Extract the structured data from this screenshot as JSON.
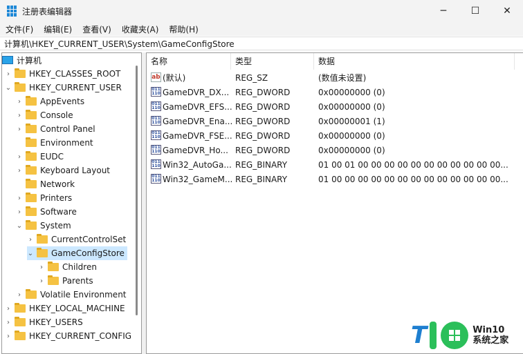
{
  "window": {
    "title": "注册表编辑器",
    "minimize": "─",
    "maximize": "☐",
    "close": "✕"
  },
  "menu": [
    "文件(F)",
    "编辑(E)",
    "查看(V)",
    "收藏夹(A)",
    "帮助(H)"
  ],
  "address": "计算机\\HKEY_CURRENT_USER\\System\\GameConfigStore",
  "tree": [
    {
      "label": "计算机",
      "level": -1,
      "icon": "computer-icon",
      "chevron": ""
    },
    {
      "label": "HKEY_CLASSES_ROOT",
      "level": 0,
      "chevron": "›"
    },
    {
      "label": "HKEY_CURRENT_USER",
      "level": 0,
      "chevron": "⌄"
    },
    {
      "label": "AppEvents",
      "level": 1,
      "chevron": "›"
    },
    {
      "label": "Console",
      "level": 1,
      "chevron": "›"
    },
    {
      "label": "Control Panel",
      "level": 1,
      "chevron": "›"
    },
    {
      "label": "Environment",
      "level": 1,
      "chevron": ""
    },
    {
      "label": "EUDC",
      "level": 1,
      "chevron": "›"
    },
    {
      "label": "Keyboard Layout",
      "level": 1,
      "chevron": "›"
    },
    {
      "label": "Network",
      "level": 1,
      "chevron": ""
    },
    {
      "label": "Printers",
      "level": 1,
      "chevron": "›"
    },
    {
      "label": "Software",
      "level": 1,
      "chevron": "›"
    },
    {
      "label": "System",
      "level": 1,
      "chevron": "⌄"
    },
    {
      "label": "CurrentControlSet",
      "level": 2,
      "chevron": "›"
    },
    {
      "label": "GameConfigStore",
      "level": 2,
      "chevron": "⌄",
      "selected": true
    },
    {
      "label": "Children",
      "level": 3,
      "chevron": "›"
    },
    {
      "label": "Parents",
      "level": 3,
      "chevron": "›"
    },
    {
      "label": "Volatile Environment",
      "level": 1,
      "chevron": "›"
    },
    {
      "label": "HKEY_LOCAL_MACHINE",
      "level": 0,
      "chevron": "›"
    },
    {
      "label": "HKEY_USERS",
      "level": 0,
      "chevron": "›"
    },
    {
      "label": "HKEY_CURRENT_CONFIG",
      "level": 0,
      "chevron": "›"
    }
  ],
  "columns": [
    "名称",
    "类型",
    "数据"
  ],
  "values": [
    {
      "name": "(默认)",
      "type": "REG_SZ",
      "data": "(数值未设置)",
      "icon": "ab"
    },
    {
      "name": "GameDVR_DX...",
      "type": "REG_DWORD",
      "data": "0x00000000 (0)",
      "icon": "bin"
    },
    {
      "name": "GameDVR_EFS...",
      "type": "REG_DWORD",
      "data": "0x00000000 (0)",
      "icon": "bin"
    },
    {
      "name": "GameDVR_Ena...",
      "type": "REG_DWORD",
      "data": "0x00000001 (1)",
      "icon": "bin"
    },
    {
      "name": "GameDVR_FSE...",
      "type": "REG_DWORD",
      "data": "0x00000000 (0)",
      "icon": "bin"
    },
    {
      "name": "GameDVR_Ho...",
      "type": "REG_DWORD",
      "data": "0x00000000 (0)",
      "icon": "bin"
    },
    {
      "name": "Win32_AutoGa...",
      "type": "REG_BINARY",
      "data": "01 00 01 00 00 00 00 00 00 00 00 00 00 00...",
      "icon": "bin"
    },
    {
      "name": "Win32_GameM...",
      "type": "REG_BINARY",
      "data": "01 00 00 00 00 00 00 00 00 00 00 00 00 00...",
      "icon": "bin"
    }
  ],
  "watermark": {
    "line1": "Win10",
    "line2": "系统之家"
  }
}
